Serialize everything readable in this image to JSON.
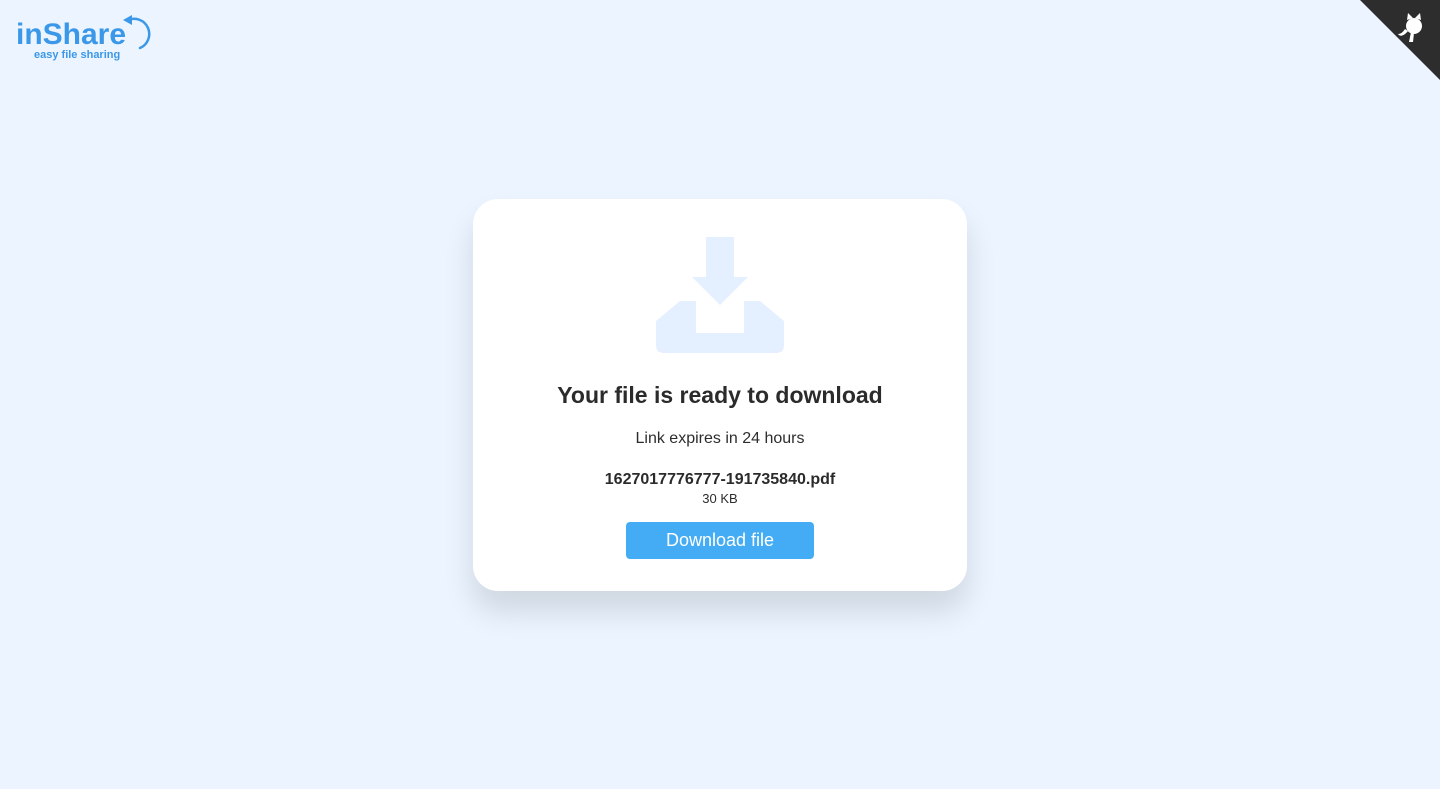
{
  "brand": {
    "name": "inShare",
    "tagline": "easy file sharing",
    "color": "#3b98e8"
  },
  "github_corner": {
    "icon": "github-octocat-icon",
    "color": "#2d2d2d"
  },
  "card": {
    "icon": "download-tray-icon",
    "icon_color": "#e4f0ff",
    "title": "Your file is ready to download",
    "expires_text": "Link expires in 24 hours",
    "file_name": "1627017776777-191735840.pdf",
    "file_size": "30 KB",
    "download_label": "Download file",
    "button_color": "#44acf4"
  }
}
